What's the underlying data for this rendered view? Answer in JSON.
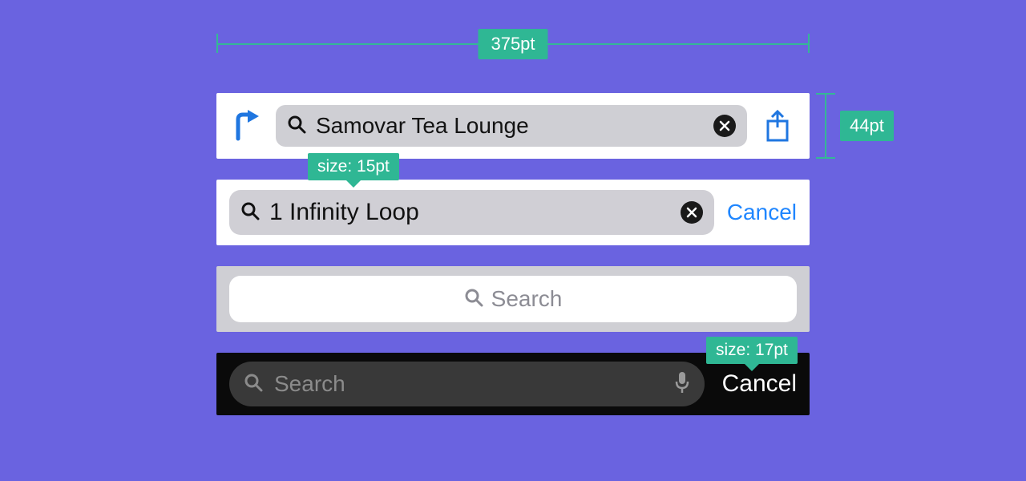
{
  "annotations": {
    "width_label": "375pt",
    "height_label": "44pt",
    "size_label_1": "size: 15pt",
    "size_label_2": "size: 17pt"
  },
  "bar1": {
    "search_text": "Samovar Tea Lounge"
  },
  "bar2": {
    "search_text": "1 Infinity Loop",
    "cancel_label": "Cancel"
  },
  "bar3": {
    "placeholder": "Search"
  },
  "bar4": {
    "placeholder": "Search",
    "cancel_label": "Cancel"
  },
  "colors": {
    "background": "#6a63e0",
    "accent": "#2fb794",
    "ios_blue": "#1f86ff"
  }
}
